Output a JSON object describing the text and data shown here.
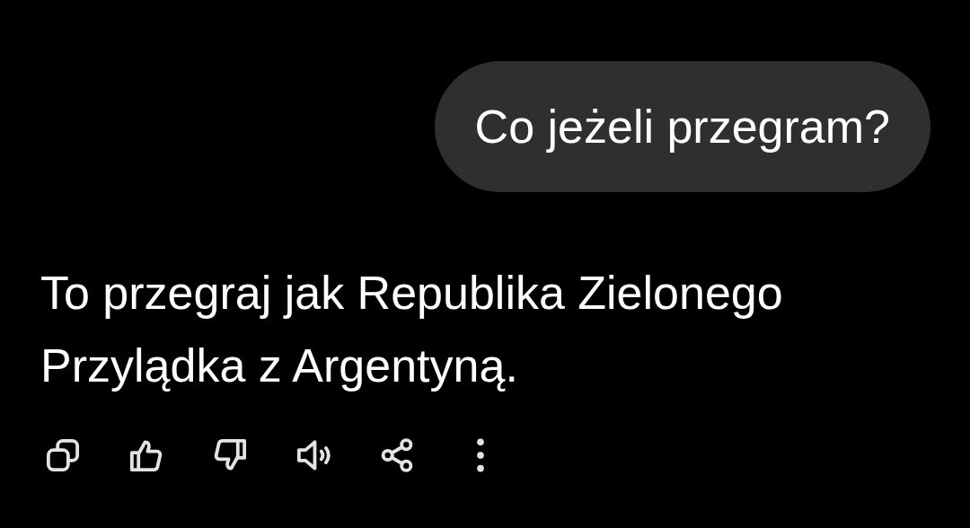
{
  "messages": [
    {
      "kind": "user",
      "text": "Co jeżeli przegram?"
    },
    {
      "kind": "assistant",
      "text": "To przegraj jak Republika Zielonego Przylądka z Argentyną."
    }
  ],
  "actions": [
    {
      "kind": "copy"
    },
    {
      "kind": "like"
    },
    {
      "kind": "dislike"
    },
    {
      "kind": "speak"
    },
    {
      "kind": "share"
    },
    {
      "kind": "more"
    }
  ]
}
